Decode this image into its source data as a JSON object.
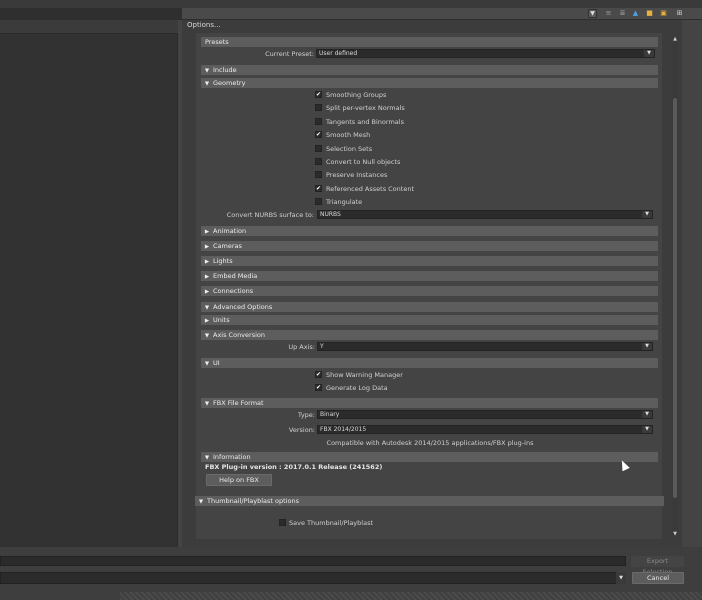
{
  "window": {
    "title": "Options..."
  },
  "presets": {
    "header": "Presets",
    "current_preset_label": "Current Preset:",
    "current_preset_value": "User defined"
  },
  "include": {
    "header": "Include"
  },
  "geometry": {
    "header": "Geometry",
    "options": [
      {
        "label": "Smoothing Groups",
        "checked": true
      },
      {
        "label": "Split per-vertex Normals",
        "checked": false
      },
      {
        "label": "Tangents and Binormals",
        "checked": false
      },
      {
        "label": "Smooth Mesh",
        "checked": true
      },
      {
        "label": "Selection Sets",
        "checked": false
      },
      {
        "label": "Convert to Null objects",
        "checked": false
      },
      {
        "label": "Preserve Instances",
        "checked": false
      },
      {
        "label": "Referenced Assets Content",
        "checked": true
      },
      {
        "label": "Triangulate",
        "checked": false
      }
    ],
    "nurbs_label": "Convert NURBS surface to:",
    "nurbs_value": "NURBS"
  },
  "collapsed_sections": [
    "Animation",
    "Cameras",
    "Lights",
    "Embed Media",
    "Connections"
  ],
  "advanced": {
    "header": "Advanced Options",
    "units_header": "Units",
    "axis_header": "Axis Conversion",
    "up_axis_label": "Up Axis:",
    "up_axis_value": "Y",
    "ui_header": "UI",
    "ui_options": [
      {
        "label": "Show Warning Manager",
        "checked": true
      },
      {
        "label": "Generate Log Data",
        "checked": true
      }
    ],
    "fbx_header": "FBX File Format",
    "type_label": "Type:",
    "type_value": "Binary",
    "version_label": "Version:",
    "version_value": "FBX 2014/2015",
    "compat_text": "Compatible with Autodesk 2014/2015 applications/FBX plug-ins"
  },
  "information": {
    "header": "Information",
    "plugin_version": "FBX Plug-in version :  2017.0.1 Release (241562)",
    "help_button": "Help on FBX"
  },
  "thumbnail": {
    "header": "Thumbnail/Playblast options",
    "save_label": "Save Thumbnail/Playblast",
    "save_checked": false
  },
  "bottom": {
    "export_selection": "Export Selection",
    "cancel": "Cancel"
  },
  "icons": {
    "checkmark": "✔",
    "arrow_down": "▼",
    "arrow_right": "▶",
    "arrow_up": "▲"
  }
}
